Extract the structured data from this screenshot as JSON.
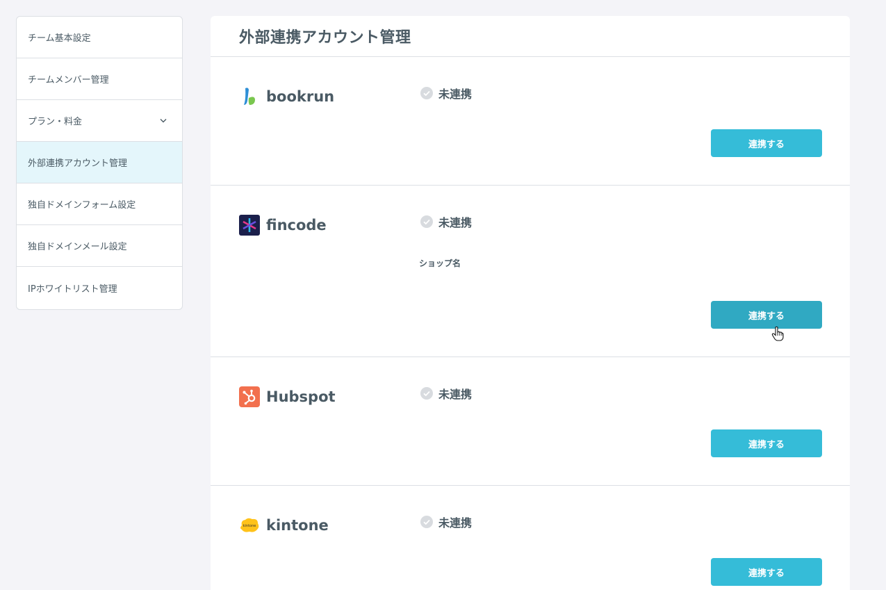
{
  "sidebar": {
    "items": [
      {
        "label": "チーム基本設定"
      },
      {
        "label": "チームメンバー管理"
      },
      {
        "label": "プラン・料金"
      },
      {
        "label": "外部連携アカウント管理"
      },
      {
        "label": "独自ドメインフォーム設定"
      },
      {
        "label": "独自ドメインメール設定"
      },
      {
        "label": "IPホワイトリスト管理"
      }
    ],
    "active_item": "外部連携アカウント管理"
  },
  "main": {
    "title": "外部連携アカウント管理",
    "integrations": [
      {
        "name": "bookrun",
        "status": "未連携",
        "button": "連携する",
        "logo_icon": "bookrun-logo-icon"
      },
      {
        "name": "fincode",
        "status": "未連携",
        "field_label": "ショップ名",
        "button": "連携する",
        "logo_icon": "fincode-logo-icon"
      },
      {
        "name": "Hubspot",
        "status": "未連携",
        "button": "連携する",
        "logo_icon": "hubspot-logo-icon"
      },
      {
        "name": "kintone",
        "status": "未連携",
        "button": "連携する",
        "logo_icon": "kintone-logo-icon",
        "logo_text": "kintone"
      }
    ]
  },
  "colors": {
    "accent": "#35bcd8",
    "accent_hover": "#30a9c2",
    "active_bg": "#e4f6fb",
    "text": "#4a5a64",
    "background": "#f4f4f8"
  }
}
